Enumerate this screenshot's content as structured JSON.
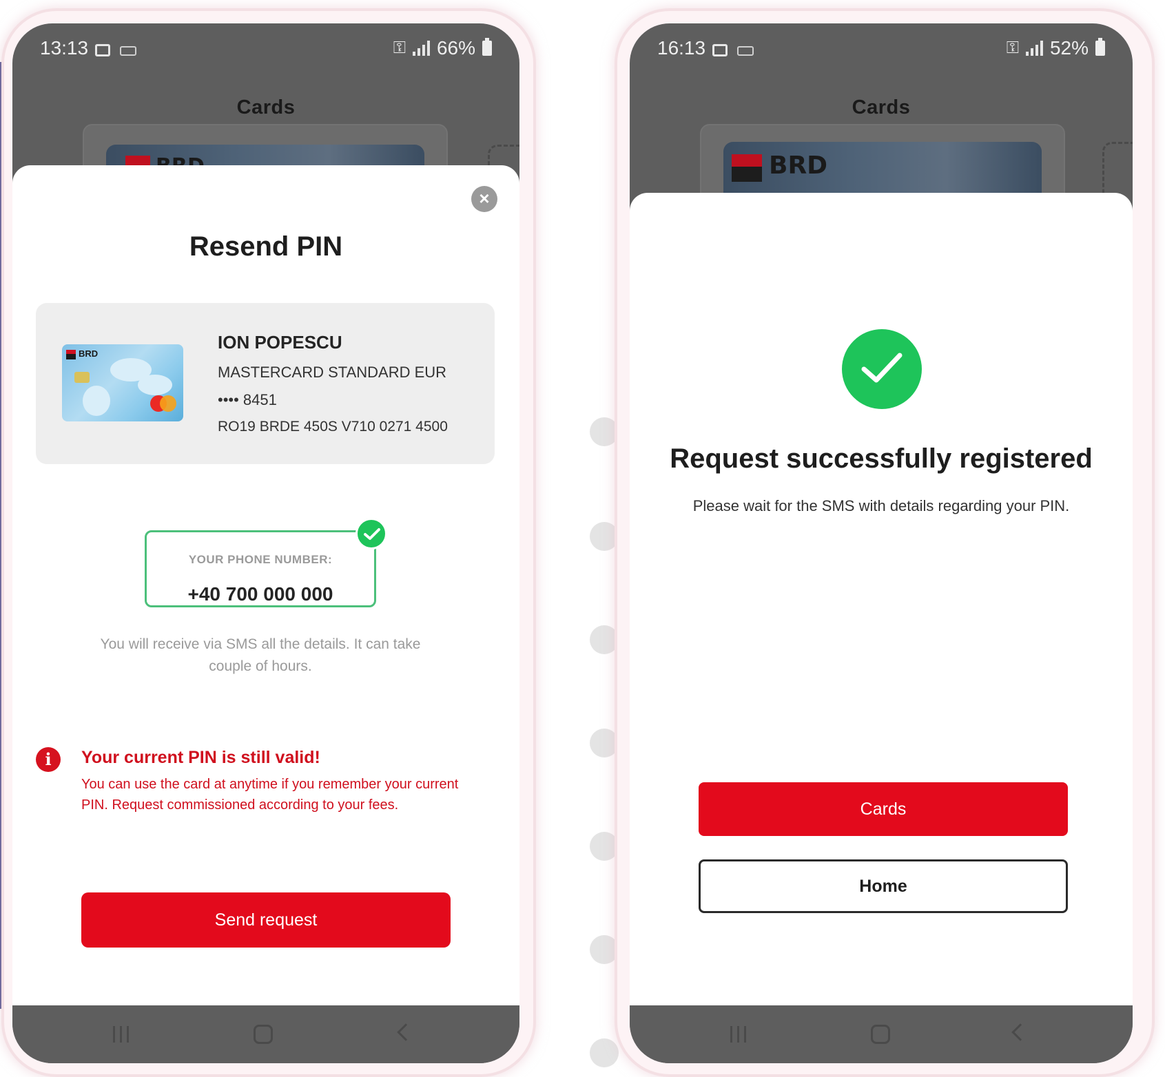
{
  "colors": {
    "brand_red": "#e30a1c",
    "alert_red": "#d0101e",
    "success_green": "#1ec45a",
    "overlay_gray": "#5e5e5e"
  },
  "left_screen": {
    "status_bar": {
      "time": "13:13",
      "battery": "66%"
    },
    "app_title": "Cards",
    "behind_card_logo": "BRD",
    "sheet": {
      "close_icon": "close-icon",
      "title": "Resend PIN",
      "card": {
        "logo": "BRD",
        "holder": "ION POPESCU",
        "type": "MASTERCARD STANDARD EUR",
        "number": "•••• 8451",
        "iban": "RO19 BRDE 450S V710 0271 4500"
      },
      "phone": {
        "label": "YOUR PHONE NUMBER:",
        "value": "+40 700 000 000"
      },
      "sms_note": "You will receive via SMS all the details. It can take couple of hours.",
      "alert": {
        "icon": "info-icon",
        "title": "Your current PIN is still valid!",
        "body": "You can use the card at anytime if you remember your current PIN. Request commissioned according to your fees."
      },
      "send_button": "Send request"
    }
  },
  "right_screen": {
    "status_bar": {
      "time": "16:13",
      "battery": "52%"
    },
    "app_title": "Cards",
    "behind_card_logo": "BRD",
    "sheet": {
      "success_icon": "check-icon",
      "title": "Request successfully registered",
      "subtitle": "Please wait for the SMS with details regarding your PIN.",
      "cards_button": "Cards",
      "home_button": "Home"
    }
  }
}
